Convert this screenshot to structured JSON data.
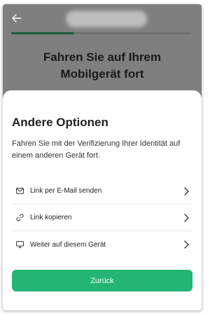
{
  "background": {
    "heading_line1": "Fahren Sie auf Ihrem",
    "heading_line2": "Mobilgerät fort",
    "progress_fraction": 0.35
  },
  "sheet": {
    "title": "Andere Optionen",
    "description": "Fahren Sie mit der Verifizierung Ihrer Identität auf einem anderen Gerät fort.",
    "options": [
      {
        "label": "Link per E-Mail senden",
        "icon": "mail-icon"
      },
      {
        "label": "Link kopieren",
        "icon": "link-icon"
      },
      {
        "label": "Weiter auf diesem Gerät",
        "icon": "monitor-icon"
      }
    ],
    "back_button_label": "Zurück"
  },
  "colors": {
    "accent": "#22b573",
    "progress": "#1a5e3e",
    "overlay": "#7f7f7f"
  }
}
